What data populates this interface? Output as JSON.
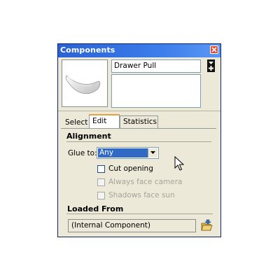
{
  "window": {
    "title": "Components"
  },
  "component": {
    "name": "Drawer Pull",
    "description": ""
  },
  "tabs": [
    {
      "label": "Select",
      "active": false
    },
    {
      "label": "Edit",
      "active": true
    },
    {
      "label": "Statistics",
      "active": false
    }
  ],
  "alignment": {
    "heading": "Alignment",
    "glue_label": "Glue to:",
    "glue_value": "Any",
    "checkboxes": [
      {
        "label": "Cut opening",
        "checked": false,
        "enabled": true
      },
      {
        "label": "Always face camera",
        "checked": false,
        "enabled": false
      },
      {
        "label": "Shadows face sun",
        "checked": false,
        "enabled": false
      }
    ]
  },
  "loaded_from": {
    "heading": "Loaded From",
    "value": "(Internal Component)"
  },
  "colors": {
    "titlebar": "#2a62d6",
    "active_tab_accent": "#e6a23a",
    "selection": "#316ac5",
    "close": "#e24b2f"
  },
  "icons": [
    "close-icon",
    "expand-icon",
    "open-file-icon",
    "cursor-icon"
  ]
}
